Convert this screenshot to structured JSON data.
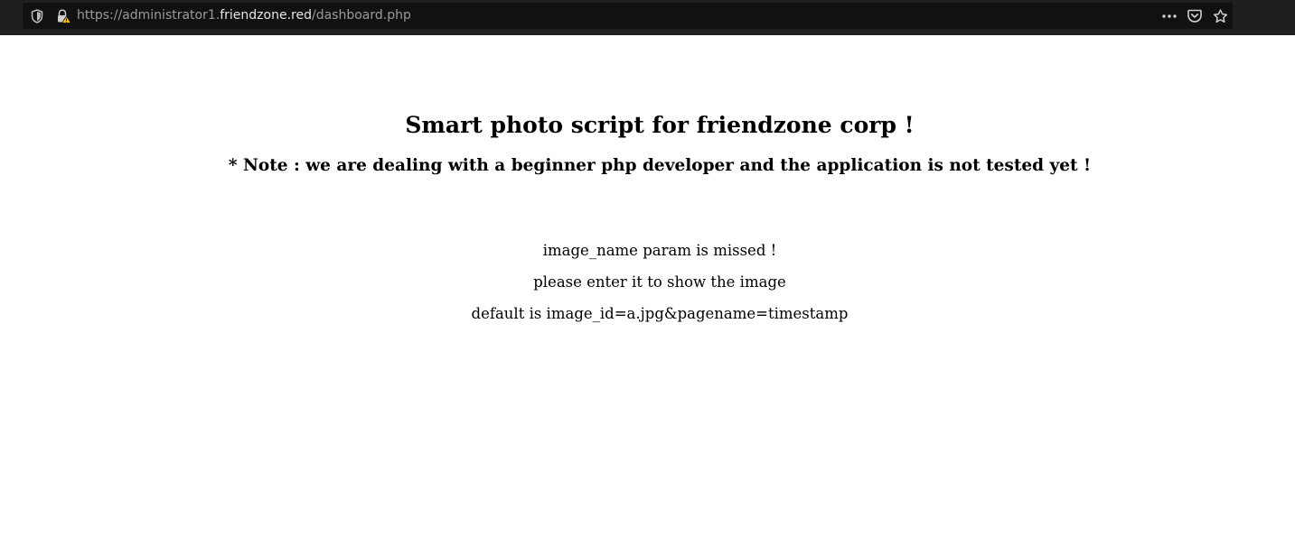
{
  "browser": {
    "url_prefix": "https://administrator1.",
    "url_host": "friendzone.red",
    "url_path": "/dashboard.php",
    "icons": [
      "shield-icon",
      "insecure-lock-icon",
      "more-icon",
      "pocket-icon",
      "star-icon"
    ]
  },
  "page": {
    "title": "Smart photo script for friendzone corp !",
    "note": "* Note : we are dealing with a beginner php developer and the application is not tested yet !",
    "messages": [
      "image_name param is missed !",
      "please enter it to show the image",
      "default is image_id=a.jpg&pagename=timestamp"
    ]
  },
  "colors": {
    "toolbar_bg": "#1f1f1f",
    "url_bg": "#111111",
    "url_dim": "#9a9a9a",
    "url_host": "#e6e6e6",
    "warning": "#f5c518"
  }
}
